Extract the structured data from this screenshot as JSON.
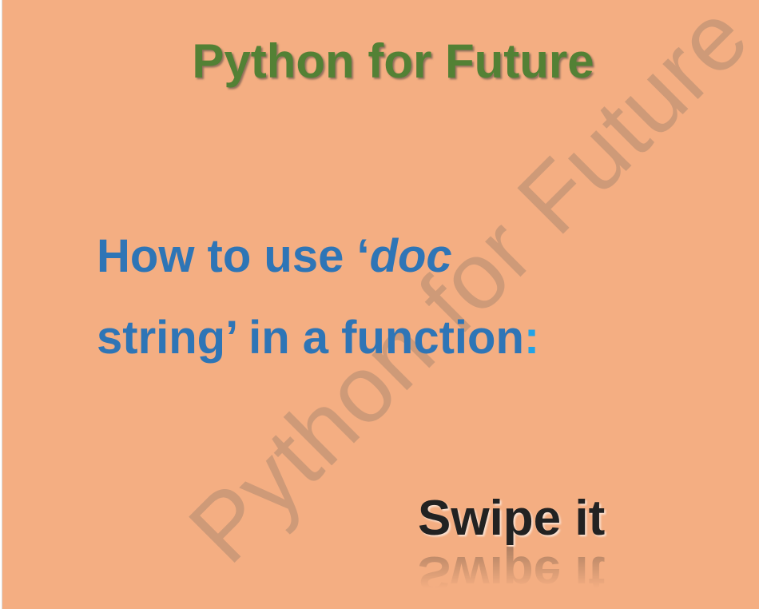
{
  "slide": {
    "header_title": "Python for Future",
    "watermark": "Python for Future",
    "headline": {
      "line1_prefix": "How to use ‘",
      "line1_italic": "doc",
      "line2_text": "string’ in a function",
      "line2_colon": ":"
    },
    "swipe_label": "Swipe it"
  },
  "colors": {
    "background": "#f4ae82",
    "header_title": "#538135",
    "headline": "#2e75b6",
    "colon_accent": "#21a3e6",
    "swipe": "#222222"
  }
}
